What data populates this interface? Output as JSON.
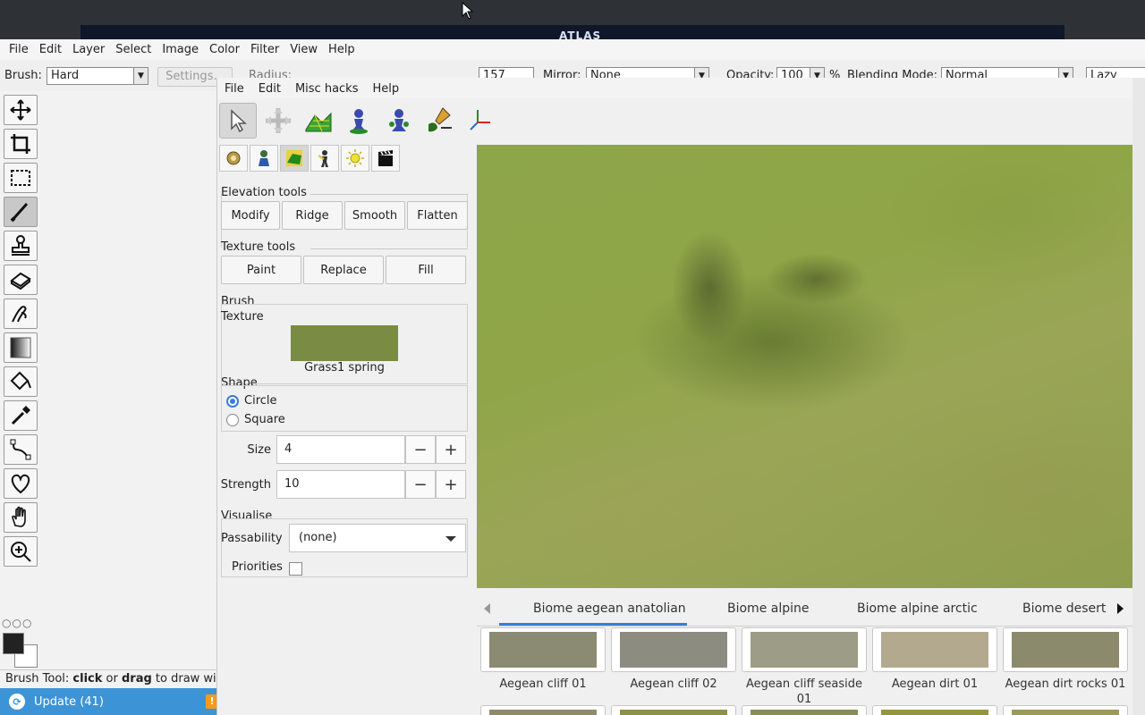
{
  "bg_app": {
    "menu": [
      "File",
      "Edit",
      "Layer",
      "Select",
      "Image",
      "Color",
      "Filter",
      "View",
      "Help"
    ],
    "brush_label": "Brush:",
    "brush_value": "Hard",
    "settings_label": "Settings...",
    "radius_label": "Radius:",
    "radius_value": "157",
    "mirror_label": "Mirror:",
    "mirror_value": "None",
    "opacity_label": "Opacity:",
    "opacity_value": "100",
    "opacity_unit": "%",
    "blending_label": "Blending Mode:",
    "blending_value": "Normal",
    "lazy_label": "Lazy Mou",
    "status_prefix": "Brush Tool: ",
    "status_click": "click",
    "status_mid": " or ",
    "status_drag": "drag",
    "status_suffix": " to draw with",
    "tools": [
      "move-icon",
      "crop-icon",
      "rect-select-icon",
      "brush-icon",
      "stamp-icon",
      "eraser-icon",
      "smudge-icon",
      "gradient-icon",
      "fill-icon",
      "eyedropper-icon",
      "path-icon",
      "heart-icon",
      "hand-icon",
      "zoom-icon"
    ],
    "dots": "○○○"
  },
  "taskbar": {
    "update_label": "Update (41)",
    "warn": "!"
  },
  "desktop": {
    "logo_text": "ATLAS"
  },
  "atlas": {
    "menu": [
      "File",
      "Edit",
      "Misc hacks",
      "Help"
    ],
    "elevation_title": "Elevation tools",
    "elevation_buttons": [
      "Modify",
      "Ridge",
      "Smooth",
      "Flatten"
    ],
    "texture_title": "Texture tools",
    "texture_buttons": [
      "Paint",
      "Replace",
      "Fill"
    ],
    "brush_title": "Brush",
    "texture_label": "Texture",
    "texture_name": "Grass1 spring",
    "shape_title": "Shape",
    "shape_options": [
      "Circle",
      "Square"
    ],
    "size_label": "Size",
    "size_value": "4",
    "strength_label": "Strength",
    "strength_value": "10",
    "minus": "−",
    "plus": "+",
    "visualise_title": "Visualise",
    "passability_label": "Passability",
    "passability_value": "(none)",
    "priorities_label": "Priorities",
    "tabs": [
      "Biome aegean anatolian",
      "Biome alpine",
      "Biome alpine arctic",
      "Biome desert"
    ],
    "tiles": [
      {
        "label": "Aegean cliff 01",
        "color": "#8b8a72"
      },
      {
        "label": "Aegean cliff 02",
        "color": "#8c8c80"
      },
      {
        "label": "Aegean cliff seaside 01",
        "color": "#9d9c86"
      },
      {
        "label": "Aegean dirt 01",
        "color": "#b3a98e"
      },
      {
        "label": "Aegean dirt rocks 01",
        "color": "#8c8a6c"
      }
    ],
    "tiles_row2_colors": [
      "#8f8a6a",
      "#8e9148",
      "#8a8d56",
      "#93963f",
      "#9a9a5a"
    ],
    "viewport_colors": {
      "grass": "#8da64a",
      "accent": "#3a7cd9"
    }
  }
}
